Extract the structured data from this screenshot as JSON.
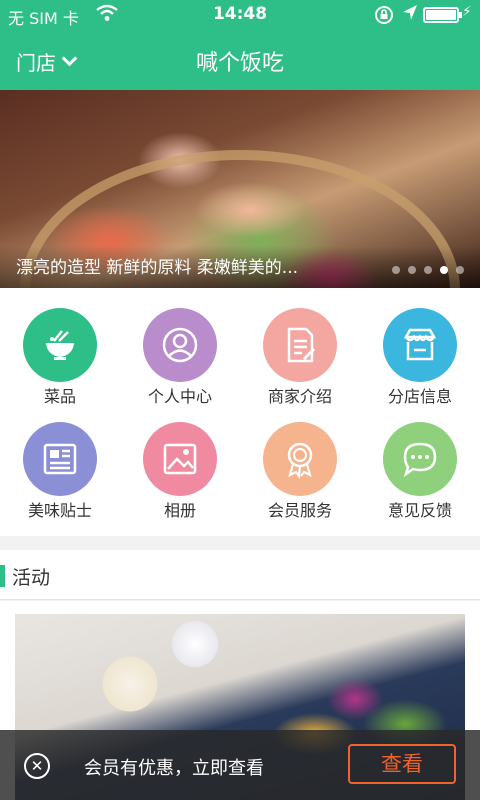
{
  "status_bar": {
    "carrier": "无 SIM 卡",
    "time": "14:48"
  },
  "nav": {
    "store_label": "门店",
    "title": "喊个饭吃"
  },
  "banner": {
    "caption": "漂亮的造型 新鲜的原料 柔嫩鲜美的...",
    "slide_count": 5,
    "active_slide": 4
  },
  "menu": [
    {
      "label": "菜品",
      "icon": "food-bowl-icon",
      "color": "#2dbf87"
    },
    {
      "label": "个人中心",
      "icon": "user-icon",
      "color": "#b98ccb"
    },
    {
      "label": "商家介绍",
      "icon": "document-icon",
      "color": "#f3a7a0"
    },
    {
      "label": "分店信息",
      "icon": "store-icon",
      "color": "#3bb6de"
    },
    {
      "label": "美味贴士",
      "icon": "newspaper-icon",
      "color": "#8b8fd6"
    },
    {
      "label": "相册",
      "icon": "photo-icon",
      "color": "#f08aa0"
    },
    {
      "label": "会员服务",
      "icon": "badge-icon",
      "color": "#f5b48e"
    },
    {
      "label": "意见反馈",
      "icon": "chat-icon",
      "color": "#8fd07d"
    }
  ],
  "activity": {
    "title": "活动"
  },
  "promo": {
    "message": "会员有优惠，立即查看",
    "button": "查看"
  },
  "colors": {
    "brand": "#2dbf87",
    "promo_accent": "#f0632a"
  }
}
